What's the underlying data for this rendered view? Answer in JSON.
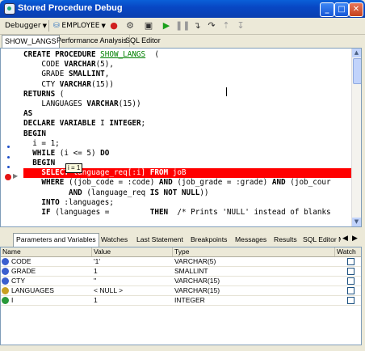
{
  "window": {
    "title": "Stored Procedure Debug",
    "min": "_",
    "max": "□",
    "close": "✕"
  },
  "toolbar": {
    "debugger_label": "Debugger",
    "db_label": "EMPLOYEE"
  },
  "tabs": [
    "SHOW_LANGS",
    "Performance Analysis",
    "SQL Editor"
  ],
  "code": {
    "lines": [
      [
        [
          "kw",
          "CREATE PROCEDURE "
        ],
        [
          "lnk",
          "SHOW_LANGS"
        ],
        [
          "",
          "  ("
        ]
      ],
      [
        [
          "",
          "    CODE "
        ],
        [
          "kw",
          "VARCHAR"
        ],
        [
          "",
          "(5),"
        ]
      ],
      [
        [
          "",
          "    GRADE "
        ],
        [
          "kw",
          "SMALLINT"
        ],
        [
          "",
          ","
        ]
      ],
      [
        [
          "",
          "    CTY "
        ],
        [
          "kw",
          "VARCHAR"
        ],
        [
          "",
          "(15))"
        ]
      ],
      [
        [
          "kw",
          "RETURNS"
        ],
        [
          "",
          " ("
        ]
      ],
      [
        [
          "",
          "    LANGUAGES "
        ],
        [
          "kw",
          "VARCHAR"
        ],
        [
          "",
          "(15))"
        ]
      ],
      [
        [
          "kw",
          "AS"
        ]
      ],
      [
        [
          "kw",
          "DECLARE VARIABLE"
        ],
        [
          "",
          " I "
        ],
        [
          "kw",
          "INTEGER"
        ],
        [
          "",
          ";"
        ]
      ],
      [
        [
          "kw",
          "BEGIN"
        ]
      ],
      [
        [
          "",
          "  i = 1;"
        ]
      ],
      [
        [
          "kw",
          "  WHILE"
        ],
        [
          "",
          " (i <= 5) "
        ],
        [
          "kw",
          "DO"
        ]
      ],
      [
        [
          "kw",
          "  BEGIN"
        ]
      ],
      [
        [
          "kw",
          "    SELECT"
        ],
        [
          "",
          " language_req[:i] "
        ],
        [
          "kw",
          "FROM"
        ],
        [
          "",
          " joB"
        ]
      ],
      [
        [
          "kw",
          "    WHERE"
        ],
        [
          "",
          " ((job_code = :code) "
        ],
        [
          "kw",
          "AND"
        ],
        [
          "",
          " (job_grade = :grade) "
        ],
        [
          "kw",
          "AND"
        ],
        [
          "",
          " (job_cour"
        ]
      ],
      [
        [
          "",
          "          "
        ],
        [
          "kw",
          "AND"
        ],
        [
          "",
          " (language_req "
        ],
        [
          "kw",
          "IS NOT NULL"
        ],
        [
          "",
          "))"
        ]
      ],
      [
        [
          "kw",
          "    INTO"
        ],
        [
          "",
          " :languages;"
        ]
      ],
      [
        [
          "kw",
          "    IF"
        ],
        [
          "",
          " (languages = "
        ],
        [
          "",
          "        "
        ],
        [
          "kw",
          "THEN"
        ],
        [
          "",
          "  "
        ],
        [
          "",
          "/* Prints 'NULL' instead of blanks"
        ]
      ]
    ],
    "tooltip": "i = 1"
  },
  "panel_tabs": [
    "Parameters and Variables",
    "Watches",
    "Last Statement",
    "Breakpoints",
    "Messages",
    "Results",
    "SQL Editor M"
  ],
  "grid": {
    "headers": [
      "Name",
      "Value",
      "Type",
      "Watch"
    ],
    "rows": [
      {
        "name": "CODE",
        "value": "'1'",
        "type": "VARCHAR(5)",
        "color": "#3a5fcf"
      },
      {
        "name": "GRADE",
        "value": "1",
        "type": "SMALLINT",
        "color": "#3a5fcf"
      },
      {
        "name": "CTY",
        "value": "''",
        "type": "VARCHAR(15)",
        "color": "#3a5fcf"
      },
      {
        "name": "LANGUAGES",
        "value": "< NULL >",
        "type": "VARCHAR(15)",
        "color": "#c8a020"
      },
      {
        "name": "I",
        "value": "1",
        "type": "INTEGER",
        "color": "#2a9a3a"
      }
    ]
  }
}
